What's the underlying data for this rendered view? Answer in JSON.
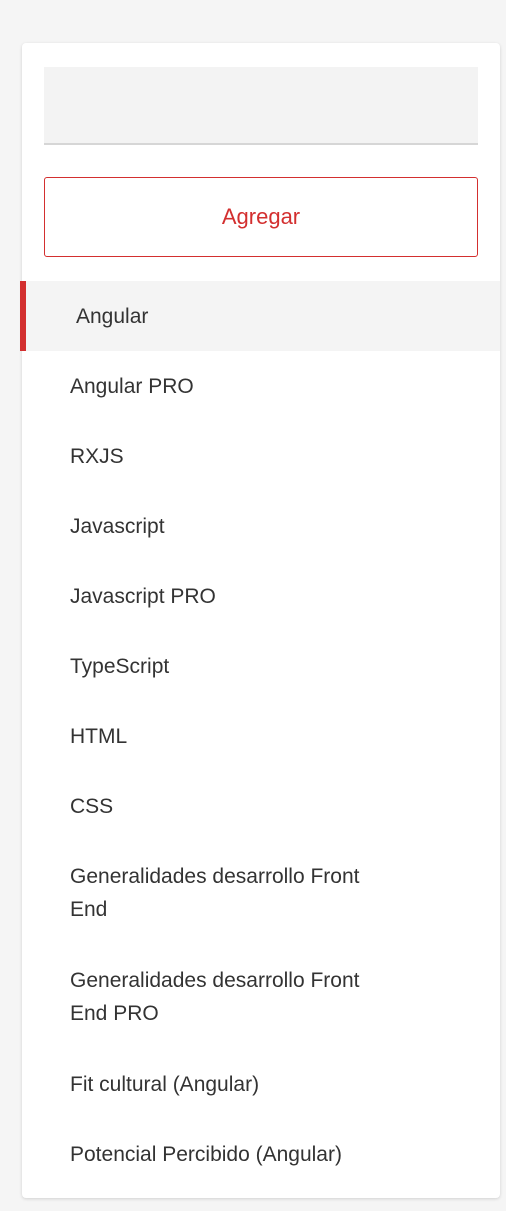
{
  "search": {
    "value": "",
    "placeholder": ""
  },
  "add_button": {
    "label": "Agregar"
  },
  "accent_color": "#d32f2f",
  "items": [
    {
      "label": "Angular",
      "active": true
    },
    {
      "label": "Angular PRO",
      "active": false
    },
    {
      "label": "RXJS",
      "active": false
    },
    {
      "label": "Javascript",
      "active": false
    },
    {
      "label": "Javascript PRO",
      "active": false
    },
    {
      "label": "TypeScript",
      "active": false
    },
    {
      "label": "HTML",
      "active": false
    },
    {
      "label": "CSS",
      "active": false
    },
    {
      "label": "Generalidades desarrollo Front End",
      "active": false
    },
    {
      "label": "Generalidades desarrollo Front End PRO",
      "active": false
    },
    {
      "label": "Fit cultural (Angular)",
      "active": false
    },
    {
      "label": "Potencial Percibido (Angular)",
      "active": false
    }
  ]
}
